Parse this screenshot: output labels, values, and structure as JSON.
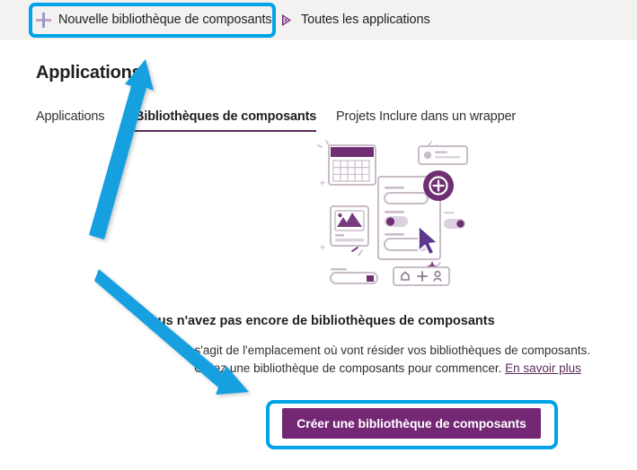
{
  "commandbar": {
    "new_library": {
      "label": "Nouvelle bibliothèque de composants",
      "icon": "plus-icon"
    },
    "all_apps": {
      "label": "Toutes les applications",
      "icon": "play-triangle-icon"
    }
  },
  "page": {
    "title": "Applications"
  },
  "tabs": [
    {
      "label": "Applications",
      "active": false
    },
    {
      "label": "Bibliothèques de composants",
      "active": true
    },
    {
      "label": "Projets Inclure dans un wrapper",
      "active": false
    }
  ],
  "empty_state": {
    "heading": "Vous n'avez pas encore de bibliothèques de composants",
    "body": "Il s'agit de l'emplacement où vont résider vos bibliothèques de composants. Créez une bibliothèque de composants pour commencer. ",
    "link": "En savoir plus",
    "illustration_name": "component-library-empty-illustration"
  },
  "primary_button": {
    "label": "Créer une bibliothèque de composants"
  },
  "annotations": {
    "highlight_color": "#00a2e8",
    "arrow_up_name": "annotation-arrow-to-tab",
    "arrow_down_name": "annotation-arrow-to-create-button"
  },
  "colors": {
    "accent_purple": "#742774",
    "tab_underline": "#5c2d59",
    "highlight_blue": "#00a2e8",
    "commandbar_bg": "#f3f2f1",
    "text_primary": "#201f1e"
  }
}
